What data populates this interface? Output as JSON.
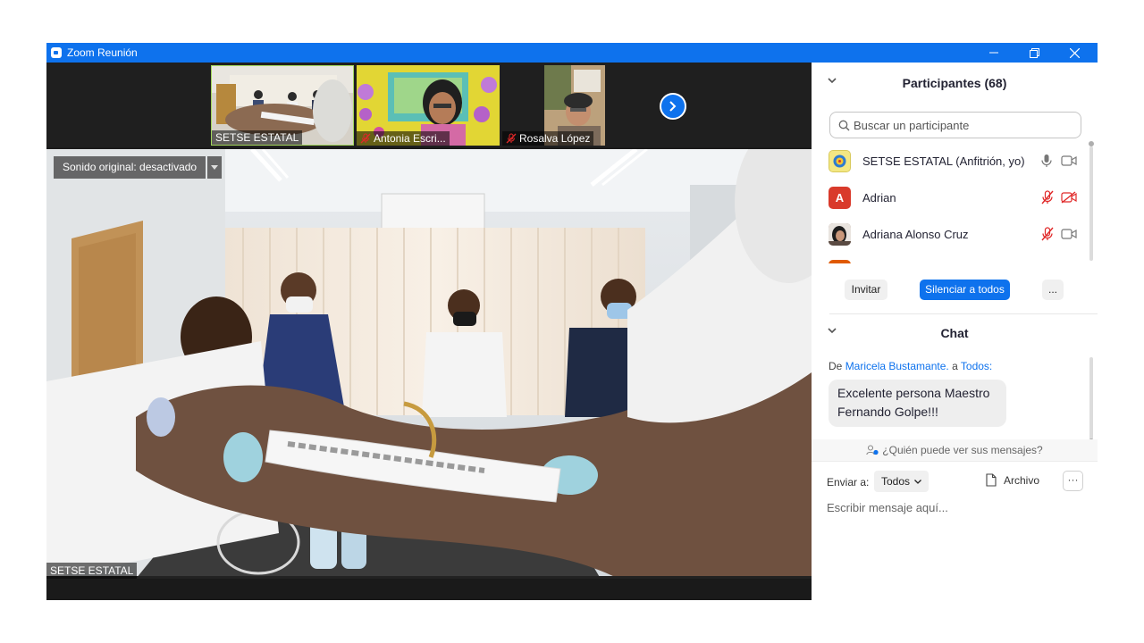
{
  "window": {
    "title": "Zoom Reunión"
  },
  "colors": {
    "accent": "#0e72ed",
    "muted_red": "#e02828"
  },
  "thumbnails": [
    {
      "name": "SETSE ESTATAL",
      "muted": false,
      "active": true
    },
    {
      "name": "Antonia Escri...",
      "muted": true,
      "active": false
    },
    {
      "name": "Rosalva López",
      "muted": true,
      "active": false
    }
  ],
  "main_video": {
    "sound_option": "Sonido original: desactivado",
    "speaker_name": "SETSE ESTATAL"
  },
  "participants": {
    "title": "Participantes (68)",
    "search_placeholder": "Buscar un participante",
    "list": [
      {
        "name": "SETSE ESTATAL (Anfitrión, yo)",
        "avatar": "logo",
        "mic": "on",
        "video": "on"
      },
      {
        "name": "Adrian",
        "avatar": "A",
        "avatar_color": "#d93a2b",
        "mic": "muted",
        "video": "off"
      },
      {
        "name": "Adriana Alonso Cruz",
        "avatar": "photo",
        "mic": "muted",
        "video": "on"
      },
      {
        "name": "",
        "avatar": "",
        "avatar_color": "#e05a00",
        "mic": "muted",
        "video": "on"
      }
    ],
    "buttons": {
      "invite": "Invitar",
      "mute_all": "Silenciar a todos",
      "more": "..."
    }
  },
  "chat": {
    "title": "Chat",
    "message": {
      "prefix": "De",
      "sender": "Maricela Bustamante.",
      "to_label": "a",
      "recipient": "Todos:",
      "text_line1": "Excelente persona Maestro",
      "text_line2": "Fernando Golpe!!!"
    },
    "who_can_see": "¿Quién puede ver sus mensajes?",
    "send_to_label": "Enviar a:",
    "send_to_value": "Todos",
    "file_label": "Archivo",
    "more": "···",
    "input_placeholder": "Escribir mensaje aquí..."
  }
}
